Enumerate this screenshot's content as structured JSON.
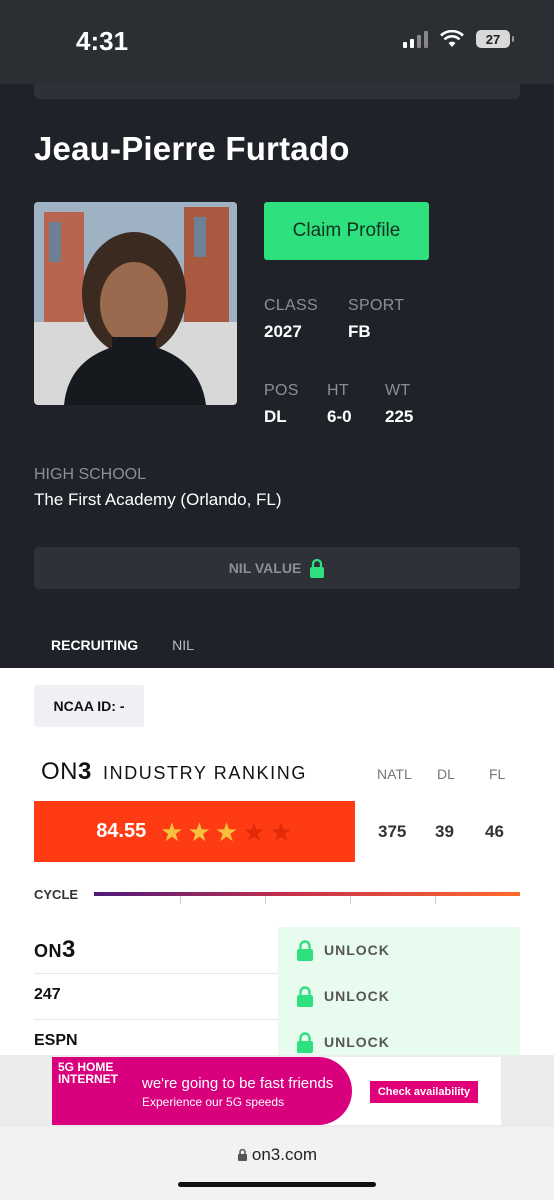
{
  "status_bar": {
    "time": "4:31",
    "battery": "27"
  },
  "player": {
    "name": "Jeau-Pierre Furtado",
    "claim_label": "Claim Profile",
    "class_label": "CLASS",
    "class_value": "2027",
    "sport_label": "SPORT",
    "sport_value": "FB",
    "pos_label": "POS",
    "pos_value": "DL",
    "ht_label": "HT",
    "ht_value": "6-0",
    "wt_label": "WT",
    "wt_value": "225",
    "hs_label": "HIGH SCHOOL",
    "hs_value": "The First Academy (Orlando, FL)",
    "nil_label": "NIL VALUE"
  },
  "tabs": [
    {
      "label": "RECRUITING"
    },
    {
      "label": "NIL"
    }
  ],
  "ncaa": {
    "label": "NCAA ID:  -"
  },
  "ranking": {
    "logo_on": "ON",
    "logo_3": "3",
    "title": "INDUSTRY RANKING",
    "col_natl": "NATL",
    "col_pos": "DL",
    "col_state": "FL",
    "rating": "84.55",
    "stars_filled": 3,
    "stars_total": 5,
    "natl": "375",
    "pos": "39",
    "state": "46"
  },
  "cycle": {
    "label": "CYCLE"
  },
  "sources": [
    {
      "name": "ON3",
      "action": "UNLOCK"
    },
    {
      "name": "247",
      "action": "UNLOCK"
    },
    {
      "name": "ESPN",
      "action": "UNLOCK"
    }
  ],
  "ad": {
    "brand": "5G HOME INTERNET",
    "headline": "we're going to be fast friends",
    "subline": "Experience our 5G speeds",
    "cta": "Check availability"
  },
  "browser": {
    "url": "on3.com"
  },
  "colors": {
    "accent_green": "#2fe07f",
    "rating_red": "#ff3b14",
    "star_gold": "#f6c23e",
    "ad_magenta": "#d9007e"
  }
}
